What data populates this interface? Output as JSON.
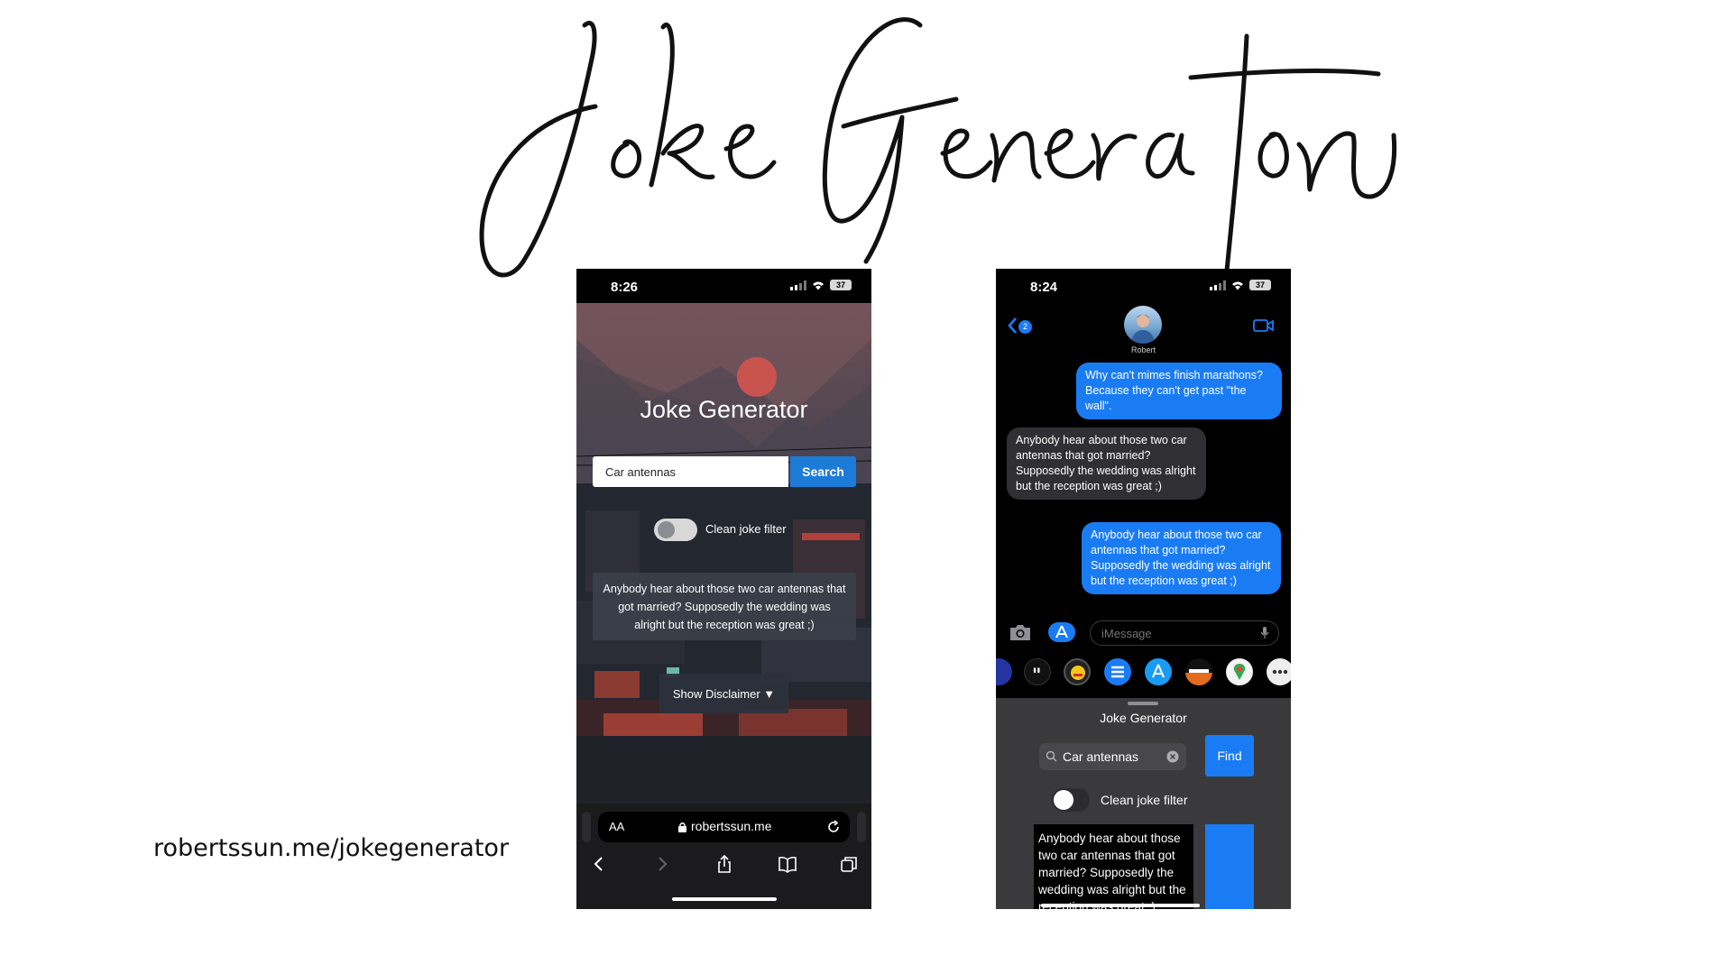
{
  "slide": {
    "title": "Joke Generator",
    "caption": "robertssun.me/jokegenerator"
  },
  "web_phone": {
    "status": {
      "time": "8:26",
      "battery": "37"
    },
    "page_title": "Joke Generator",
    "search": {
      "value": "Car antennas",
      "button_label": "Search"
    },
    "filter": {
      "label": "Clean joke filter",
      "enabled": false
    },
    "joke": "Anybody hear about those two car antennas that got married? Supposedly the wedding was alright but the reception was great ;)",
    "disclaimer_button": "Show Disclaimer ▼",
    "safari": {
      "text_size_label": "AA",
      "url": "robertssun.me",
      "icons": [
        "lock-icon",
        "reload-icon",
        "back-icon",
        "forward-icon",
        "share-icon",
        "bookmarks-icon",
        "tabs-icon"
      ]
    }
  },
  "messages_phone": {
    "status": {
      "time": "8:24",
      "battery": "37"
    },
    "header": {
      "contact_name": "Robert",
      "back_badge": "2"
    },
    "bubbles": [
      {
        "from": "me",
        "text": "Why can't mimes finish marathons? Because they can't get past \"the wall\"."
      },
      {
        "from": "them",
        "text": "Anybody hear about those two car antennas that got married? Supposedly the wedding was alright but the reception was great ;)"
      },
      {
        "from": "me",
        "text": "Anybody hear about those two car antennas that got married? Supposedly the wedding was alright but the reception was great ;)"
      }
    ],
    "compose": {
      "placeholder": "iMessage"
    },
    "app_drawer": [
      "globe-app-icon",
      "quotes-app-icon",
      "emoji-app-icon",
      "lists-app-icon",
      "app-store-icon",
      "discover-app-icon",
      "maps-app-icon",
      "more-apps-icon"
    ],
    "extension": {
      "title": "Joke Generator",
      "search": {
        "value": "Car antennas",
        "button_label": "Find"
      },
      "filter": {
        "label": "Clean joke filter",
        "enabled": false
      },
      "joke": "Anybody hear about those two car antennas that got married? Supposedly the wedding was alright but the reception was great ;)"
    }
  },
  "colors": {
    "ios_blue": "#1a7cf5",
    "web_search_blue": "#1d7bd8",
    "received_bubble": "#303034",
    "extension_panel": "#3a3a3c"
  }
}
